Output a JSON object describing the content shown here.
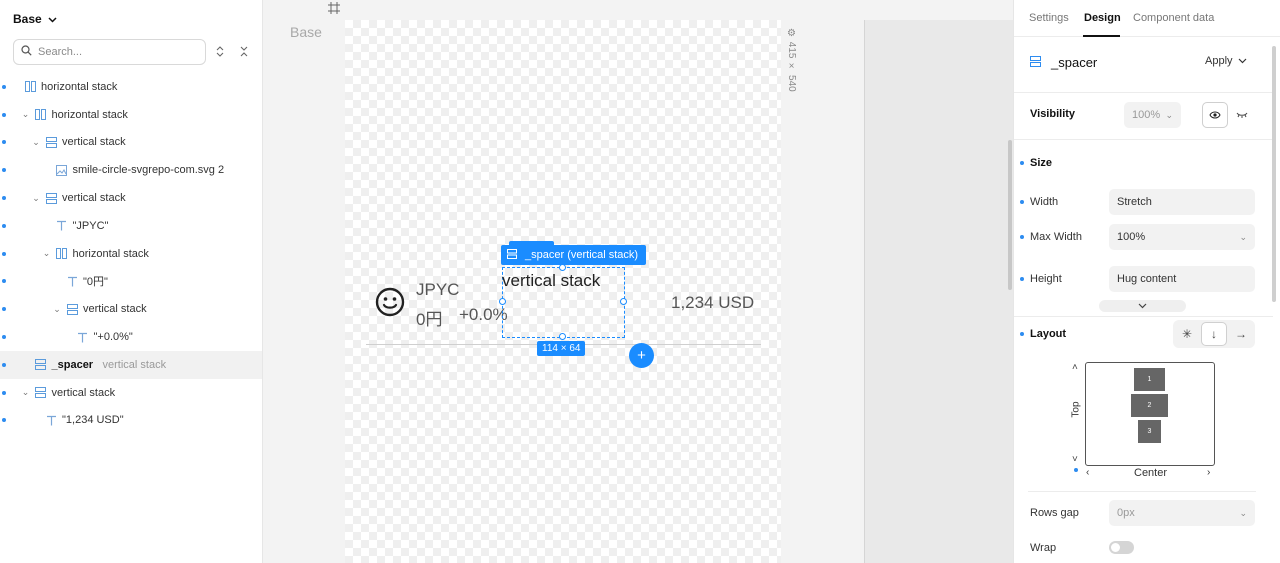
{
  "left": {
    "title": "Base",
    "search_placeholder": "Search...",
    "layers": [
      {
        "label": "horizontal stack",
        "type": "hstack",
        "depth": 0,
        "chevron": false
      },
      {
        "label": "horizontal stack",
        "type": "hstack",
        "depth": 1,
        "chevron": true
      },
      {
        "label": "vertical stack",
        "type": "vstack",
        "depth": 2,
        "chevron": true
      },
      {
        "label": "smile-circle-svgrepo-com.svg 2",
        "type": "image",
        "depth": 3,
        "chevron": false
      },
      {
        "label": "vertical stack",
        "type": "vstack",
        "depth": 2,
        "chevron": true
      },
      {
        "label": "\"JPYC\"",
        "type": "text",
        "depth": 3,
        "chevron": false
      },
      {
        "label": "horizontal stack",
        "type": "hstack",
        "depth": 3,
        "chevron": true
      },
      {
        "label": "\"0円\"",
        "type": "text",
        "depth": 4,
        "chevron": false
      },
      {
        "label": "vertical stack",
        "type": "vstack",
        "depth": 4,
        "chevron": true
      },
      {
        "label": "\"+0.0%\"",
        "type": "text",
        "depth": 5,
        "chevron": false
      },
      {
        "label": "_spacer",
        "sub": "vertical stack",
        "type": "vstack",
        "depth": 1,
        "chevron": false,
        "selected": true
      },
      {
        "label": "vertical stack",
        "type": "vstack",
        "depth": 1,
        "chevron": true
      },
      {
        "label": "\"1,234 USD\"",
        "type": "text",
        "depth": 2,
        "chevron": false
      }
    ]
  },
  "canvas": {
    "base_label": "Base",
    "frame_size": "415 × 540",
    "jpyc": "JPYC",
    "yen": "0円",
    "pct": "+0.0%",
    "usd": "1,234 USD",
    "selection_label": "_spacer (vertical stack)",
    "selection_text": "vertical stack",
    "dimensions": "114 × 64",
    "add": "+"
  },
  "right": {
    "tabs": [
      "Settings",
      "Design",
      "Component data"
    ],
    "component_name": "_spacer",
    "apply": "Apply",
    "visibility_label": "Visibility",
    "visibility_value": "100%",
    "size_label": "Size",
    "width_label": "Width",
    "width_value": "Stretch",
    "max_width_label": "Max Width",
    "max_width_value": "100%",
    "height_label": "Height",
    "height_value": "Hug content",
    "layout_label": "Layout",
    "align_vertical": "Top",
    "align_horizontal": "Center",
    "blocks": [
      "1",
      "2",
      "3"
    ],
    "rows_gap_label": "Rows gap",
    "rows_gap_value": "0px",
    "wrap_label": "Wrap",
    "accent": "#1a8cff"
  }
}
